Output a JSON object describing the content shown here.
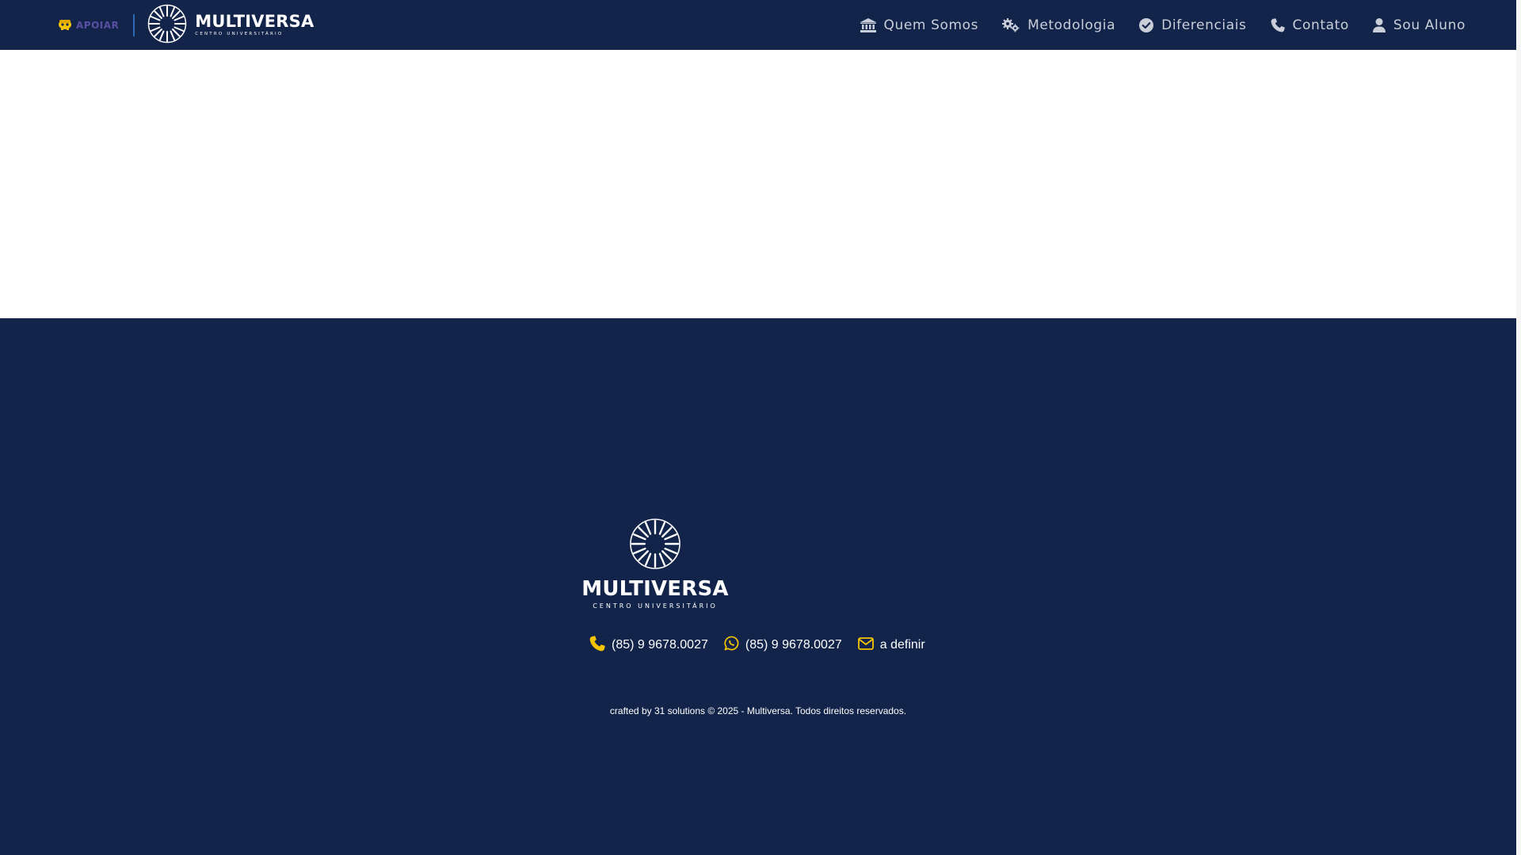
{
  "header": {
    "partner_logo_text": "APOIAR",
    "brand_name": "MULTIVERSA",
    "brand_tagline": "CENTRO UNIVERSITÁRIO",
    "nav": [
      {
        "label": "Quem Somos",
        "icon": "institution-icon"
      },
      {
        "label": "Metodologia",
        "icon": "gears-icon"
      },
      {
        "label": "Diferenciais",
        "icon": "check-circle-icon"
      },
      {
        "label": "Contato",
        "icon": "phone-icon"
      },
      {
        "label": "Sou Aluno",
        "icon": "user-icon"
      }
    ]
  },
  "footer": {
    "brand_name": "MULTIVERSA",
    "brand_tagline": "CENTRO UNIVERSITÁRIO",
    "contacts": {
      "phone": "(85) 9 9678.0027",
      "whatsapp": "(85) 9 9678.0027",
      "email": "a definir"
    },
    "copyright": "crafted by 31 solutions © 2025 - Multiversa. Todos direitos reservados."
  },
  "colors": {
    "navy": "#12244a",
    "accent_yellow": "#f5c400",
    "nav_text": "#c9ced9",
    "white": "#ffffff"
  }
}
